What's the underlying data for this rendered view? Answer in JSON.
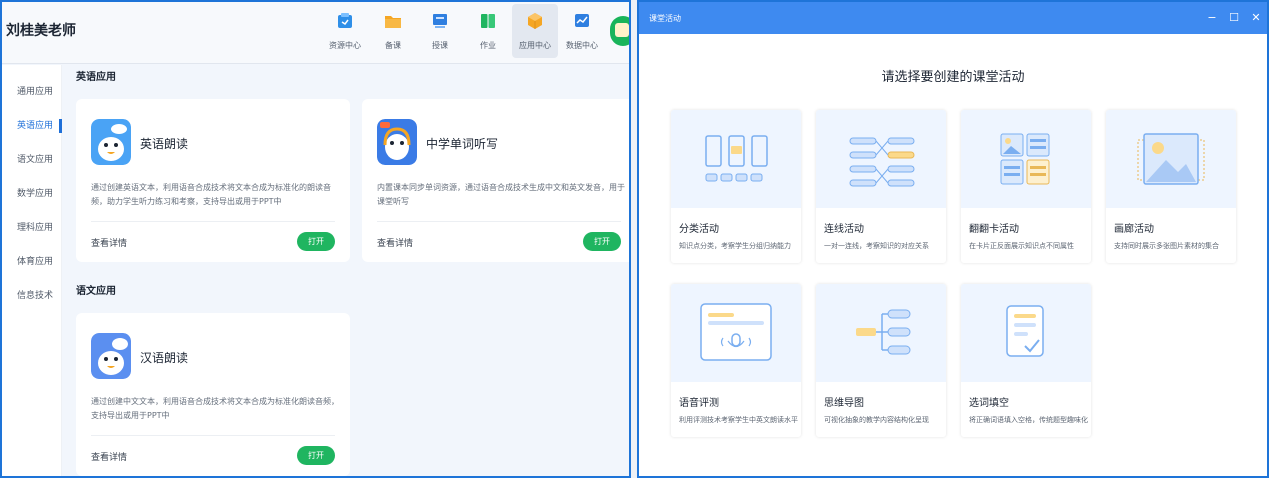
{
  "left": {
    "teacher_name": "刘桂美老师",
    "nav": [
      {
        "label": "资源中心",
        "icon": "resource-center-icon",
        "color": "#2f8fe8"
      },
      {
        "label": "备课",
        "icon": "folder-icon",
        "color": "#f5a623"
      },
      {
        "label": "授课",
        "icon": "teaching-screen-icon",
        "color": "#2f7fe0"
      },
      {
        "label": "作业",
        "icon": "book-icon",
        "color": "#1fb560"
      },
      {
        "label": "应用中心",
        "icon": "app-cube-icon",
        "color": "#f5a623",
        "active": true
      },
      {
        "label": "数据中心",
        "icon": "data-chart-icon",
        "color": "#2f7fe0"
      }
    ],
    "sidebar": [
      {
        "label": "通用应用"
      },
      {
        "label": "英语应用",
        "active": true
      },
      {
        "label": "语文应用"
      },
      {
        "label": "数学应用"
      },
      {
        "label": "理科应用"
      },
      {
        "label": "体育应用"
      },
      {
        "label": "信息技术"
      }
    ],
    "sections": [
      {
        "title": "英语应用",
        "cards": [
          {
            "title": "英语朗读",
            "desc": "通过创建英语文本，利用语音合成技术将文本合成为标准化的朗读音频，助力学生听力练习和考察，支持导出或用于PPT中",
            "detail": "查看详情",
            "button": "打开",
            "icon_color": "#4aa3f5"
          },
          {
            "title": "中学单词听写",
            "desc": "内置课本同步单词资源，通过语音合成技术生成中文和英文发音，用于课堂听写",
            "detail": "查看详情",
            "button": "打开",
            "icon_color": "#3a7be6"
          }
        ]
      },
      {
        "title": "语文应用",
        "cards": [
          {
            "title": "汉语朗读",
            "desc": "通过创建中文文本，利用语音合成技术将文本合成为标准化朗读音频，支持导出或用于PPT中",
            "detail": "查看详情",
            "button": "打开",
            "icon_color": "#5b8ff0"
          }
        ]
      }
    ],
    "accent": "#1e6fd8",
    "open_color": "#1fb560"
  },
  "right": {
    "window_title": "课堂活动",
    "window_controls": {
      "minimize": "−",
      "maximize": "☐",
      "close": "✕"
    },
    "prompt": "请选择要创建的课堂活动",
    "activities": [
      {
        "name": "分类活动",
        "desc": "知识点分类，考察学生分组归纳能力",
        "icon": "classification-icon"
      },
      {
        "name": "连线活动",
        "desc": "一对一连线，考察知识的对应关系",
        "icon": "matching-lines-icon"
      },
      {
        "name": "翻翻卡活动",
        "desc": "在卡片正反面展示知识点不同属性",
        "icon": "flip-card-icon"
      },
      {
        "name": "画廊活动",
        "desc": "支持同时展示多张图片素材的集合",
        "icon": "gallery-icon"
      },
      {
        "name": "语音评测",
        "desc": "利用评测技术考察学生中英文朗读水平",
        "icon": "voice-evaluation-icon"
      },
      {
        "name": "思维导图",
        "desc": "可视化抽象的教学内容结构化呈现",
        "icon": "mind-map-icon"
      },
      {
        "name": "选词填空",
        "desc": "将正确词语填入空格，传统题型趣味化",
        "icon": "fill-blank-icon"
      }
    ],
    "titlebar_color": "#3e8af0"
  }
}
